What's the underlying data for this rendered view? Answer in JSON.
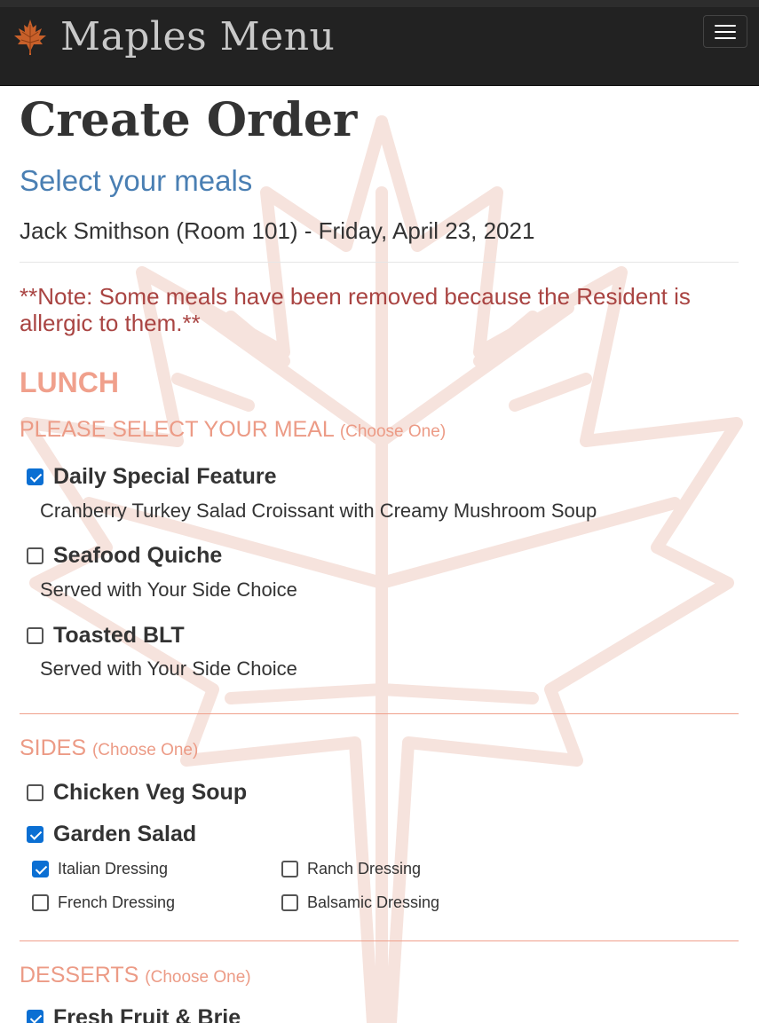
{
  "navbar": {
    "brand": "Maples Menu",
    "logo_icon": "maple-leaf-icon",
    "menu_icon": "hamburger-menu-icon"
  },
  "page": {
    "title": "Create Order",
    "subtitle": "Select your meals",
    "resident": "Jack Smithson (Room 101) - Friday, April 23, 2021",
    "note": "**Note: Some meals have been removed because the Resident is allergic to them.**"
  },
  "meal": {
    "name": "LUNCH",
    "sections": {
      "main": {
        "title": "PLEASE SELECT YOUR MEAL",
        "hint": "(Choose One)",
        "options": [
          {
            "label": "Daily Special Feature",
            "desc": "Cranberry Turkey Salad Croissant with Creamy Mushroom Soup",
            "checked": true
          },
          {
            "label": "Seafood Quiche",
            "desc": "Served with Your Side Choice",
            "checked": false
          },
          {
            "label": "Toasted BLT",
            "desc": "Served with Your Side Choice",
            "checked": false
          }
        ]
      },
      "sides": {
        "title": "SIDES",
        "hint": "(Choose One)",
        "options": [
          {
            "label": "Chicken Veg Soup",
            "checked": false
          },
          {
            "label": "Garden Salad",
            "checked": true
          }
        ],
        "dressings": [
          {
            "label": "Italian Dressing",
            "checked": true
          },
          {
            "label": "Ranch Dressing",
            "checked": false
          },
          {
            "label": "French Dressing",
            "checked": false
          },
          {
            "label": "Balsamic Dressing",
            "checked": false
          }
        ]
      },
      "desserts": {
        "title": "DESSERTS",
        "hint": "(Choose One)",
        "options": [
          {
            "label": "Fresh Fruit & Brie",
            "checked": true
          }
        ]
      }
    }
  },
  "colors": {
    "navbar": "#222222",
    "accent": "#f0a08c",
    "subtitle": "#4a7fb3",
    "note": "#a94442",
    "checkbox": "#0b6fd3"
  }
}
